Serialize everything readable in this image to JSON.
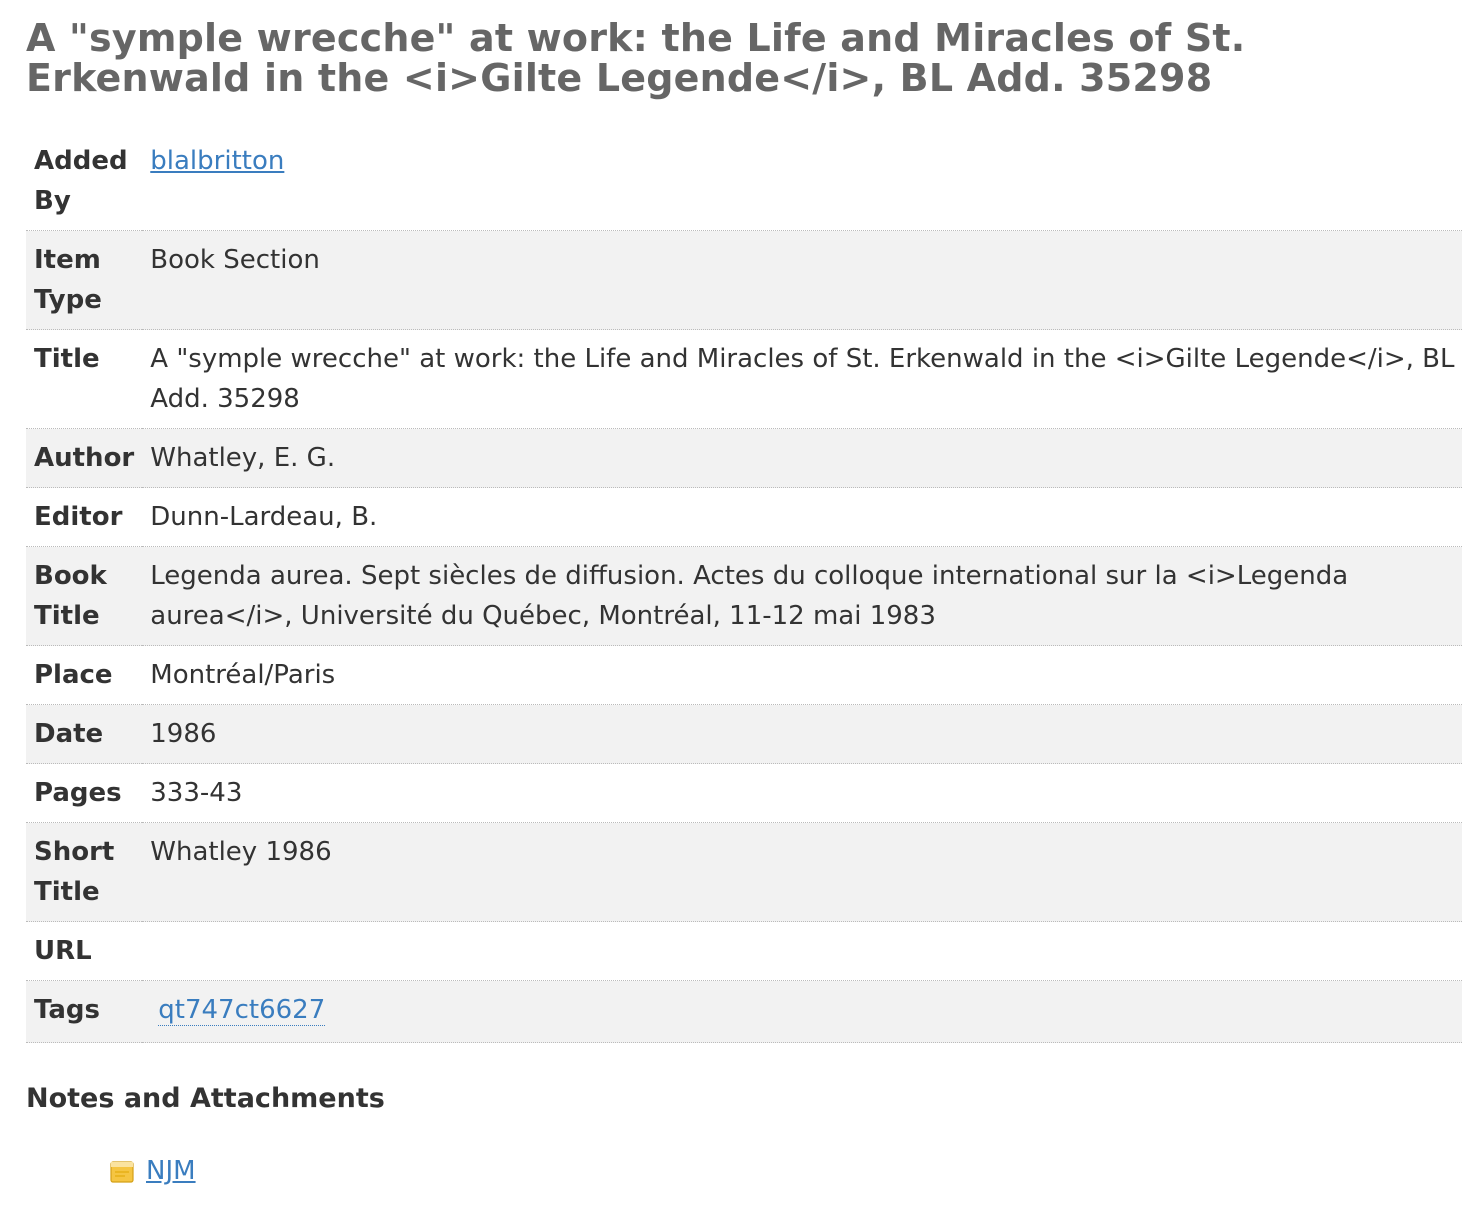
{
  "item": {
    "title": "A \"symple wrecche\" at work: the Life and Miracles of St. Erkenwald in the <i>Gilte Legende</i>, BL Add. 35298"
  },
  "fields": {
    "added_by": {
      "label": "Added By",
      "value": "blalbritton"
    },
    "item_type": {
      "label": "Item Type",
      "value": "Book Section"
    },
    "title": {
      "label": "Title",
      "value": "A \"symple wrecche\" at work: the Life and Miracles of St. Erkenwald in the <i>Gilte Legende</i>, BL Add. 35298"
    },
    "author": {
      "label": "Author",
      "value": "Whatley, E. G."
    },
    "editor": {
      "label": "Editor",
      "value": "Dunn-Lardeau, B."
    },
    "book_title": {
      "label": "Book Title",
      "value": "Legenda aurea. Sept siècles de diffusion. Actes du colloque international sur la <i>Legenda aurea</i>, Université du Québec, Montréal, 11-12 mai 1983"
    },
    "place": {
      "label": "Place",
      "value": "Montréal/Paris"
    },
    "date": {
      "label": "Date",
      "value": "1986"
    },
    "pages": {
      "label": "Pages",
      "value": "333-43"
    },
    "short_title": {
      "label": "Short Title",
      "value": "Whatley 1986"
    },
    "url": {
      "label": "URL",
      "value": ""
    },
    "tags": {
      "label": "Tags",
      "items": [
        "qt747ct6627"
      ]
    }
  },
  "notes": {
    "heading": "Notes and Attachments",
    "items": [
      {
        "label": "NJM",
        "icon": "note-icon"
      }
    ]
  },
  "colors": {
    "link": "#3a7dbf",
    "title": "#666666",
    "row_alt": "#f2f2f2",
    "note_icon": "#f5c542"
  }
}
